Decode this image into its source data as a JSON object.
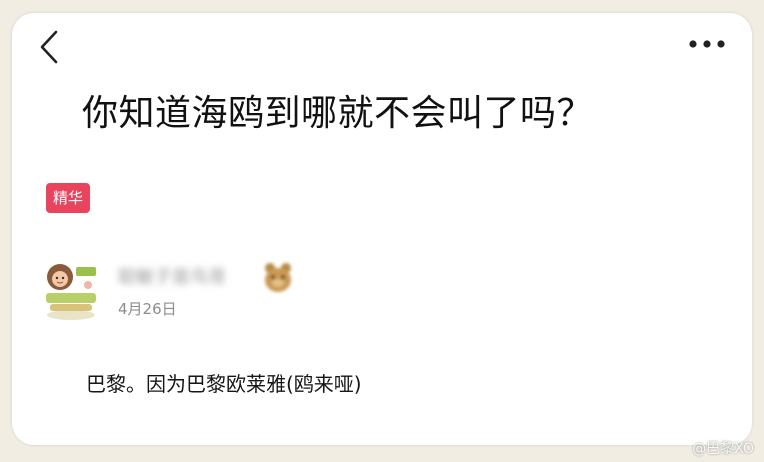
{
  "header": {
    "back_icon": "chevron-left-icon",
    "more_icon": "more-dots-icon"
  },
  "post": {
    "title": "你知道海鸥到哪就不会叫了吗？",
    "badge": "精华",
    "answer": "巴黎。因为巴黎欧莱雅(鸥来哑)"
  },
  "author": {
    "name": "聪敏子是鸟哥",
    "date": "4月26日",
    "avatar_icon": "avatar-cartoon-icon",
    "emoji_icon": "bear-emoji-icon"
  },
  "watermark": "@巴黎XO",
  "colors": {
    "badge": "#e8445e",
    "background": "#f1ede3",
    "card": "#ffffff"
  }
}
